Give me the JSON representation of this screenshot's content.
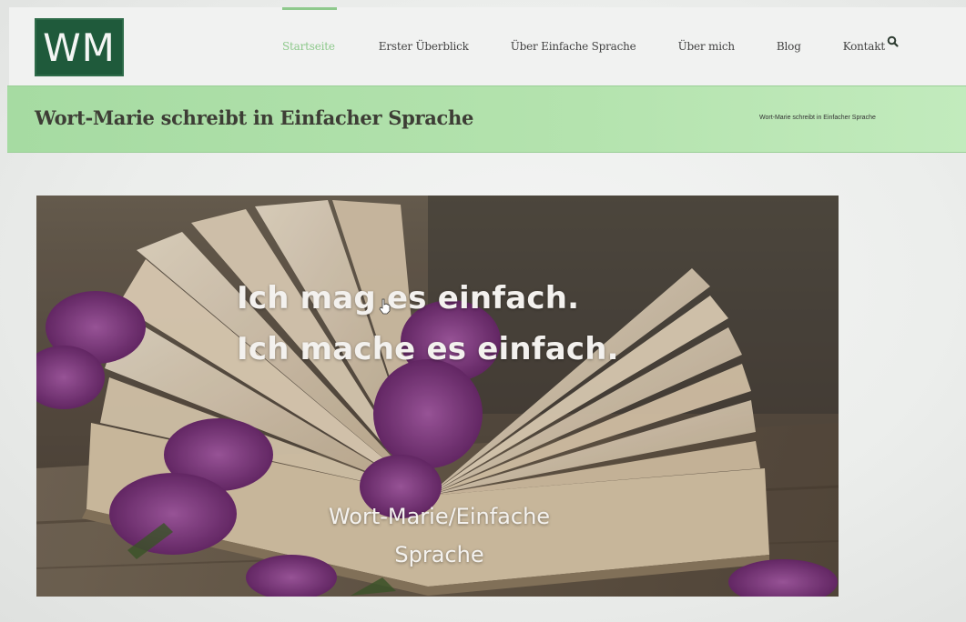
{
  "header": {
    "logo_text": "WM",
    "nav": [
      {
        "label": "Startseite",
        "active": true
      },
      {
        "label": "Erster Überblick",
        "active": false
      },
      {
        "label": "Über Einfache Sprache",
        "active": false
      },
      {
        "label": "Über mich",
        "active": false
      },
      {
        "label": "Blog",
        "active": false
      },
      {
        "label": "Kontakt",
        "active": false
      }
    ],
    "search_icon": "search-icon"
  },
  "titlebar": {
    "title": "Wort-Marie schreibt in Einfacher Sprache",
    "breadcrumb": "Wort-Marie schreibt in Einfacher Sprache"
  },
  "hero": {
    "headline_line1": "Ich mag es einfach.",
    "headline_line2": "Ich mache es einfach.",
    "subline_line1": "Wort-Marie/Einfache",
    "subline_line2": "Sprache"
  },
  "colors": {
    "logo_bg": "#1f5a3b",
    "active_nav": "#8ec98c",
    "titlebar_bg": "#b4e3ae"
  }
}
